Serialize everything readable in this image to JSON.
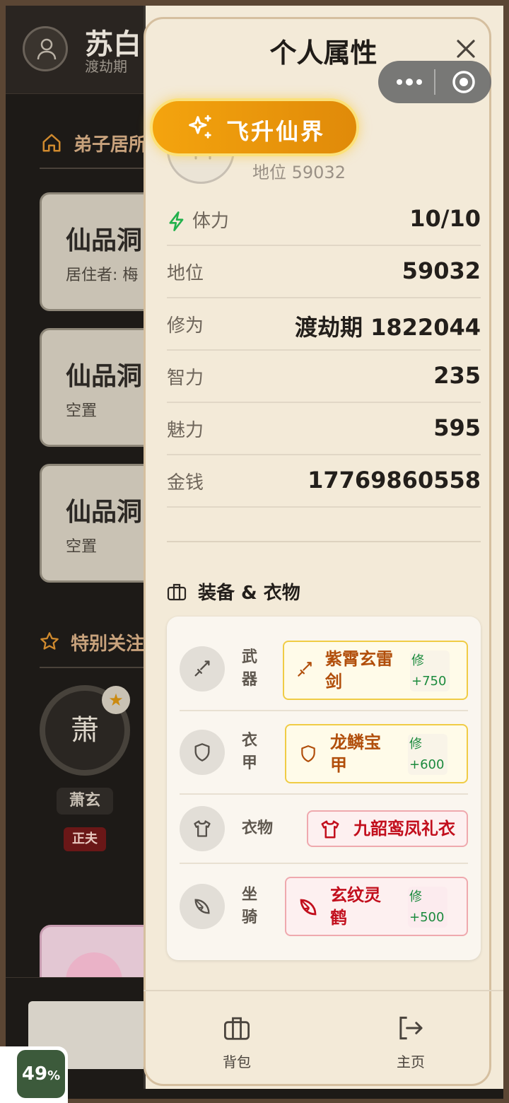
{
  "background": {
    "user_name": "苏白",
    "user_realm": "渡劫期",
    "residence_section": "弟子居所",
    "cards": [
      {
        "title": "仙品洞",
        "subtitle": "居住者: 梅"
      },
      {
        "title": "仙品洞",
        "subtitle": "空置"
      },
      {
        "title": "仙品洞",
        "subtitle": "空置"
      }
    ],
    "follow_section": "特别关注",
    "follow": {
      "avatar_char": "萧",
      "name": "萧玄",
      "tag": "正夫",
      "star": "★"
    }
  },
  "badge": {
    "value": "49",
    "unit": "%"
  },
  "panel": {
    "title": "个人属性",
    "ascend_label": "飞升仙界",
    "status_line": "地位 59032",
    "stats": [
      {
        "label": "体力",
        "value": "10/10",
        "icon": "lightning-icon"
      },
      {
        "label": "地位",
        "value": "59032"
      },
      {
        "label": "修为",
        "value": "渡劫期 1822044"
      },
      {
        "label": "智力",
        "value": "235"
      },
      {
        "label": "魅力",
        "value": "595"
      },
      {
        "label": "金钱",
        "value": "17769860558"
      }
    ],
    "equipment_title": "装备 & 衣物",
    "equipment": [
      {
        "slot_label": "武器",
        "slot_icon": "sword-icon",
        "item_icon": "sword-icon",
        "item_name": "紫霄玄雷剑",
        "bonus_label": "修",
        "bonus_value": "+750",
        "rarity": "gold"
      },
      {
        "slot_label": "衣甲",
        "slot_icon": "shield-icon",
        "item_icon": "shield-icon",
        "item_name": "龙鳞宝甲",
        "bonus_label": "修",
        "bonus_value": "+600",
        "rarity": "gold"
      },
      {
        "slot_label": "衣物",
        "slot_icon": "shirt-icon",
        "item_icon": "shirt-icon",
        "item_name": "九韶鸾凤礼衣",
        "rarity": "red"
      },
      {
        "slot_label": "坐骑",
        "slot_icon": "citrus-icon",
        "item_icon": "citrus-icon",
        "item_name": "玄纹灵鹤",
        "bonus_label": "修",
        "bonus_value": "+500",
        "rarity": "red"
      }
    ],
    "nav": [
      {
        "label": "背包",
        "icon": "briefcase-icon"
      },
      {
        "label": "主页",
        "icon": "exit-icon"
      }
    ]
  },
  "colors": {
    "accent_orange": "#f4a40e",
    "gold_border": "#f0cc45",
    "red_border": "#efa9ae",
    "bonus_green": "#1b8a3d",
    "lightning_green": "#22b14c"
  }
}
